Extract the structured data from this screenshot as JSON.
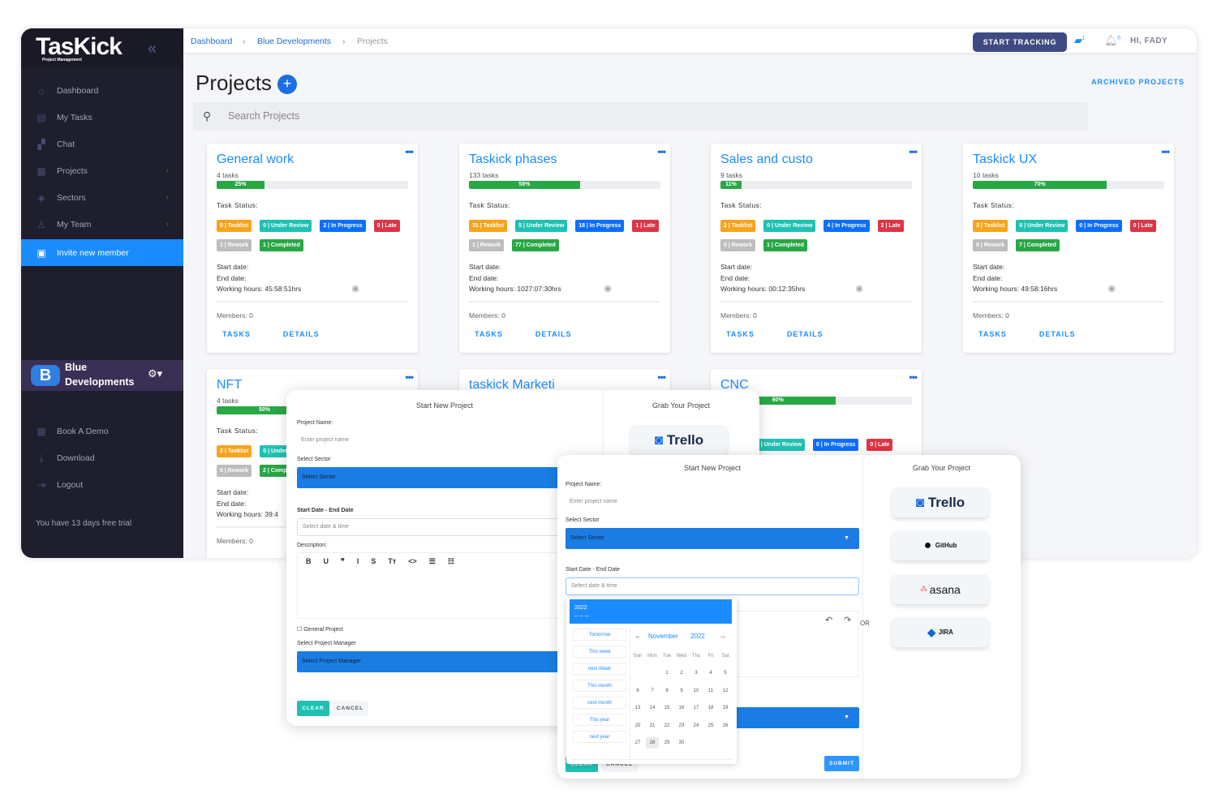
{
  "colors": {
    "accent": "#1b8cff",
    "sidebar": "#1e1e2d",
    "tasklist": "#f7a41d",
    "under_review": "#20c1b3",
    "in_progress": "#0d6efd",
    "late": "#dc3545",
    "rework": "#bdbdbd",
    "completed": "#28a745"
  },
  "sidebar": {
    "logo": "TasKick",
    "logo_sub": "Project Management",
    "items": [
      {
        "label": "Dashboard",
        "icon": "home-icon"
      },
      {
        "label": "My Tasks",
        "icon": "clipboard-icon"
      },
      {
        "label": "Chat",
        "icon": "chat-icon"
      },
      {
        "label": "Projects",
        "icon": "projects-icon",
        "chevron": true
      },
      {
        "label": "Sectors",
        "icon": "layers-icon",
        "chevron": true
      },
      {
        "label": "My Team",
        "icon": "team-icon",
        "chevron": true
      }
    ],
    "invite": "Invite new member",
    "team_line1": "Blue",
    "team_line2": "Developments",
    "bottom": [
      {
        "label": "Book A Demo",
        "icon": "calendar-icon"
      },
      {
        "label": "Download",
        "icon": "download-icon"
      },
      {
        "label": "Logout",
        "icon": "logout-icon"
      }
    ],
    "trial": "You have 13 days free trial"
  },
  "header": {
    "breadcrumb": [
      "Dashboard",
      "Blue Developments",
      "Projects"
    ],
    "start_tracking": "START TRACKING",
    "chat_badge": "1",
    "notif_badge": "0",
    "greeting": "HI, FADY"
  },
  "main": {
    "title": "Projects",
    "archived": "ARCHIVED PROJECTS",
    "search_placeholder": "Search Projects",
    "task_status_label": "Task Status:",
    "start_label": "Start date:",
    "end_label": "End date:",
    "hours_label": "Working hours:",
    "members_label": "Members:",
    "tasks_link": "TASKS",
    "details_link": "DETAILS",
    "projects": [
      {
        "name": "General work",
        "tasks": "4 tasks",
        "progress": 25,
        "status": [
          [
            "0 | Tasklist",
            "tasklist"
          ],
          [
            "0 | Under Review",
            "under_review"
          ],
          [
            "2 | In Progress",
            "in_progress"
          ],
          [
            "0 | Late",
            "late"
          ],
          [
            "1 | Rework",
            "rework"
          ],
          [
            "1 | Completed",
            "completed"
          ]
        ],
        "hours": "45:58:51hrs",
        "members": "0"
      },
      {
        "name": "Taskick phases",
        "tasks": "133 tasks",
        "progress": 58,
        "status": [
          [
            "31 | Tasklist",
            "tasklist"
          ],
          [
            "5 | Under Review",
            "under_review"
          ],
          [
            "18 | In Progress",
            "in_progress"
          ],
          [
            "1 | Late",
            "late"
          ],
          [
            "1 | Rework",
            "rework"
          ],
          [
            "77 | Completed",
            "completed"
          ]
        ],
        "hours": "1027:07:30hrs",
        "members": "0"
      },
      {
        "name": "Sales and custo",
        "tasks": "9 tasks",
        "progress": 11,
        "status": [
          [
            "2 | Tasklist",
            "tasklist"
          ],
          [
            "0 | Under Review",
            "under_review"
          ],
          [
            "4 | In Progress",
            "in_progress"
          ],
          [
            "2 | Late",
            "late"
          ],
          [
            "0 | Rework",
            "rework"
          ],
          [
            "1 | Completed",
            "completed"
          ]
        ],
        "hours": "00:12:35hrs",
        "members": "0"
      },
      {
        "name": "Taskick UX",
        "tasks": "10 tasks",
        "progress": 70,
        "status": [
          [
            "3 | Tasklist",
            "tasklist"
          ],
          [
            "0 | Under Review",
            "under_review"
          ],
          [
            "0 | In Progress",
            "in_progress"
          ],
          [
            "0 | Late",
            "late"
          ],
          [
            "0 | Rework",
            "rework"
          ],
          [
            "7 | Completed",
            "completed"
          ]
        ],
        "hours": "49:58:16hrs",
        "members": "0"
      },
      {
        "name": "NFT",
        "tasks": "4 tasks",
        "progress": 50,
        "status": [
          [
            "2 | Tasklist",
            "tasklist"
          ],
          [
            "0 | Under Review",
            "under_review"
          ],
          [
            "0 | Rework",
            "rework"
          ],
          [
            "2 | Completed",
            "completed"
          ]
        ],
        "hours": "39:4",
        "members": "0"
      },
      {
        "name": "taskick Marketi",
        "tasks": "",
        "progress": null,
        "status": [],
        "hours": "",
        "members": ""
      },
      {
        "name": "CNC",
        "tasks": "",
        "progress": 60,
        "status": [
          [
            "0 | Under Review",
            "under_review"
          ],
          [
            "0 | In Progress",
            "in_progress"
          ],
          [
            "0 | Late",
            "late"
          ]
        ],
        "hours": "",
        "members": ""
      }
    ]
  },
  "modal": {
    "title": "Start New Project",
    "grab": "Grab Your Project",
    "project_name": "Project Name:",
    "project_placeholder": "Enter project name",
    "sector_label": "Select Sector",
    "sector_value": "Select Sector",
    "dates_label": "Start Date - End Date",
    "dates_placeholder": "Select date & time",
    "description": "Description:",
    "editor_tools": [
      "B",
      "U",
      "❞",
      "I",
      "S",
      "Tт",
      "<>",
      "☰",
      "☷"
    ],
    "general": "General Project",
    "manager_label": "Select Project Manager",
    "manager_value": "Select Project Manager",
    "clear": "CLEAR",
    "cancel": "CANCEL",
    "submit": "SUBMIT",
    "or": "OR",
    "integrations": [
      "Trello",
      "GitHub",
      "asana",
      "JIRA"
    ]
  },
  "calendar": {
    "header_year": "2022",
    "header_range": "-- ~ --",
    "month": "November",
    "year": "2022",
    "presets": [
      "Tomorrow",
      "This week",
      "next Week",
      "This month",
      "next month",
      "This year",
      "next year"
    ],
    "weekdays": [
      "Sun",
      "Mon",
      "Tue",
      "Wed",
      "Thu",
      "Fri",
      "Sat"
    ],
    "first_weekday": 2,
    "days": 30,
    "selected": 28
  }
}
